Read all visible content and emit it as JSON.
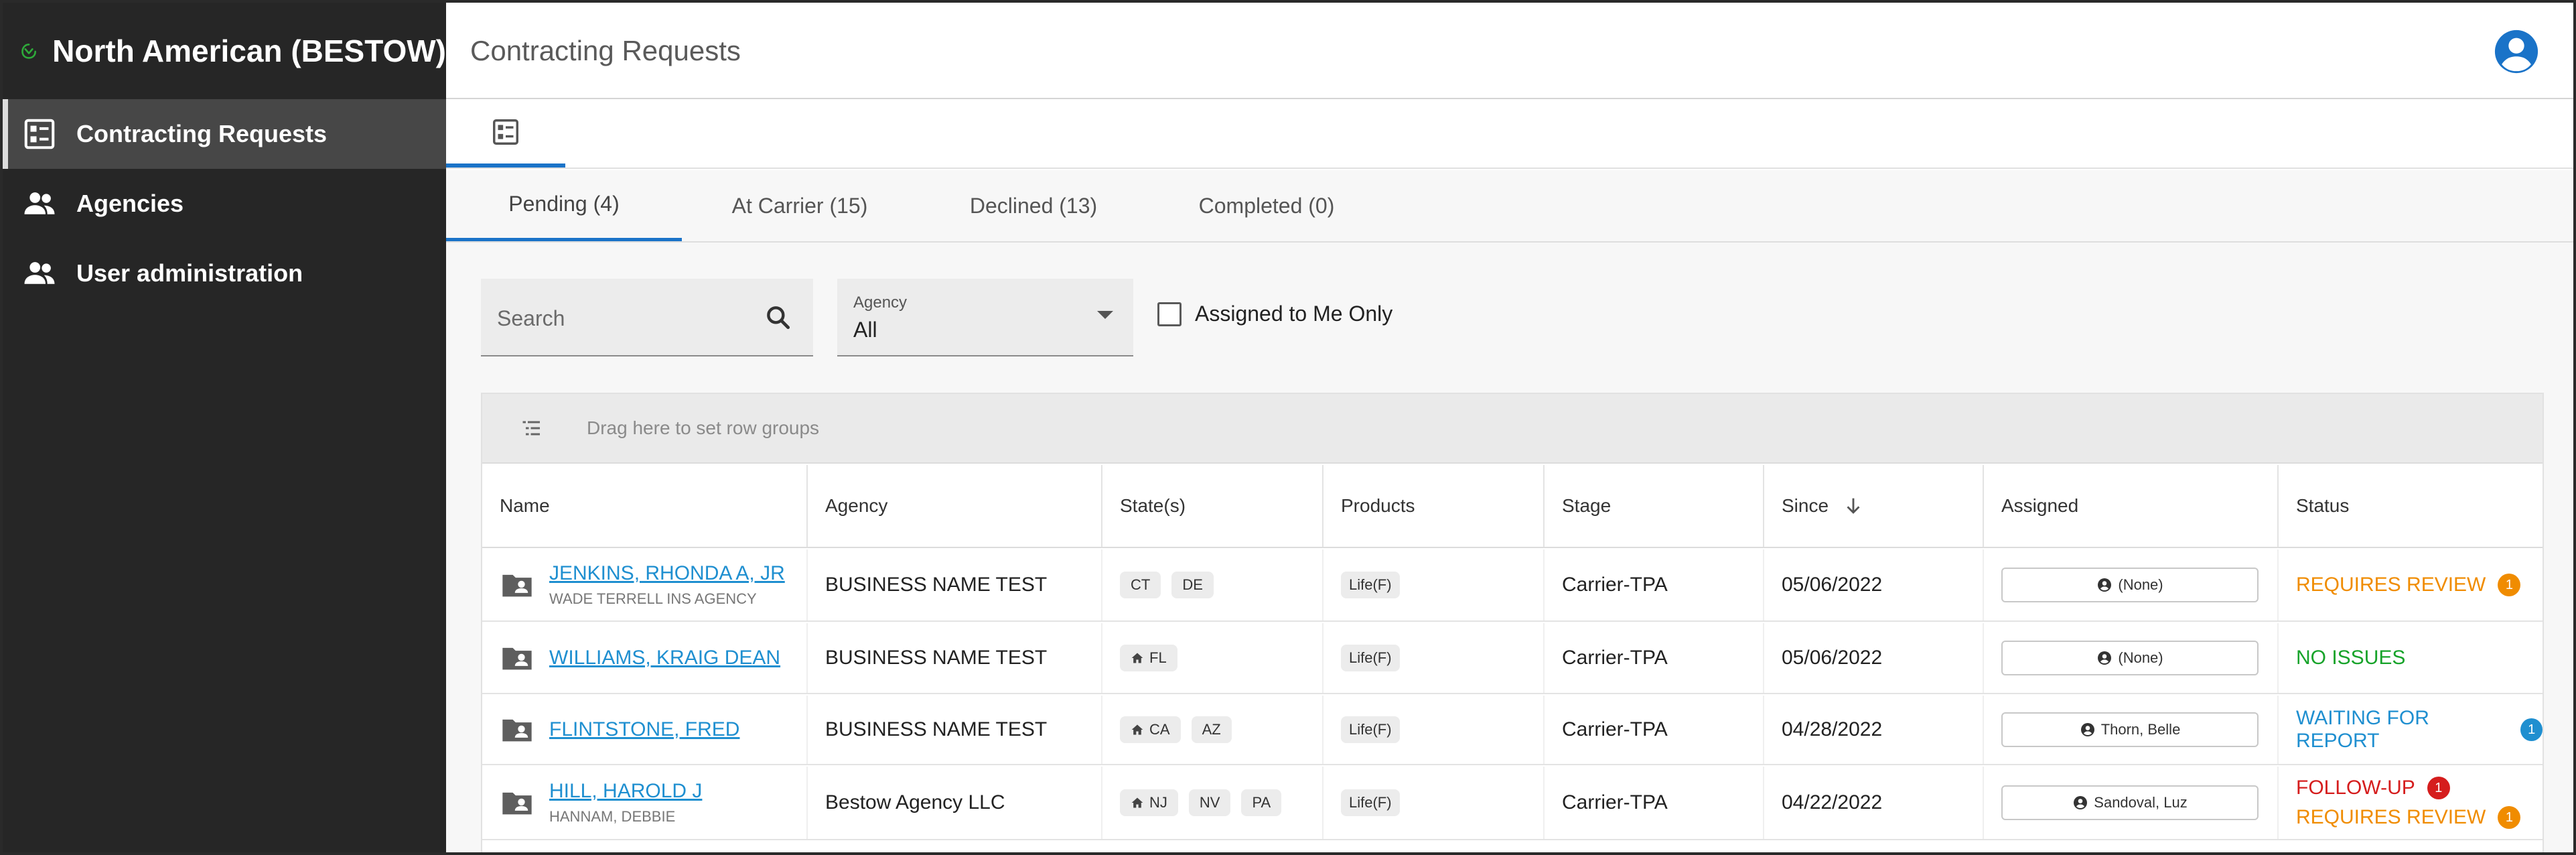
{
  "app": {
    "brand_name": "North American (BESTOW)",
    "page_title": "Contracting Requests"
  },
  "sidebar": {
    "items": [
      {
        "label": "Contracting Requests",
        "icon": "list-icon",
        "active": true
      },
      {
        "label": "Agencies",
        "icon": "people-icon",
        "active": false
      },
      {
        "label": "User administration",
        "icon": "people-icon",
        "active": false
      }
    ]
  },
  "tabs": [
    {
      "label": "Pending (4)",
      "active": true
    },
    {
      "label": "At Carrier (15)",
      "active": false
    },
    {
      "label": "Declined (13)",
      "active": false
    },
    {
      "label": "Completed (0)",
      "active": false
    }
  ],
  "filters": {
    "search_placeholder": "Search",
    "agency_label": "Agency",
    "agency_value": "All",
    "assigned_label": "Assigned to Me Only"
  },
  "grid": {
    "group_bar_text": "Drag here to set row groups",
    "columns": [
      "Name",
      "Agency",
      "State(s)",
      "Products",
      "Stage",
      "Since",
      "Assigned",
      "Status"
    ],
    "rows": [
      {
        "name": "JENKINS, RHONDA A, JR",
        "sub": "WADE TERRELL INS AGENCY",
        "agency": "BUSINESS NAME TEST",
        "states": [
          {
            "code": "CT",
            "home": false
          },
          {
            "code": "DE",
            "home": false
          }
        ],
        "product": "Life(F)",
        "stage": "Carrier-TPA",
        "since": "05/06/2022",
        "assigned": "(None)",
        "statuses": [
          {
            "text": "REQUIRES REVIEW",
            "color": "#f08c00",
            "count": "1"
          }
        ]
      },
      {
        "name": "WILLIAMS, KRAIG DEAN",
        "sub": "",
        "agency": "BUSINESS NAME TEST",
        "states": [
          {
            "code": "FL",
            "home": true
          }
        ],
        "product": "Life(F)",
        "stage": "Carrier-TPA",
        "since": "05/06/2022",
        "assigned": "(None)",
        "statuses": [
          {
            "text": "NO ISSUES",
            "color": "#17a32a",
            "count": ""
          }
        ]
      },
      {
        "name": "FLINTSTONE, FRED",
        "sub": "",
        "agency": "BUSINESS NAME TEST",
        "states": [
          {
            "code": "CA",
            "home": true
          },
          {
            "code": "AZ",
            "home": false
          }
        ],
        "product": "Life(F)",
        "stage": "Carrier-TPA",
        "since": "04/28/2022",
        "assigned": "Thorn, Belle",
        "statuses": [
          {
            "text": "WAITING FOR REPORT",
            "color": "#1f8fd0",
            "count": "1"
          }
        ]
      },
      {
        "name": "HILL, HAROLD J",
        "sub": "HANNAM, DEBBIE",
        "agency": "Bestow Agency LLC",
        "states": [
          {
            "code": "NJ",
            "home": true
          },
          {
            "code": "NV",
            "home": false
          },
          {
            "code": "PA",
            "home": false
          }
        ],
        "product": "Life(F)",
        "stage": "Carrier-TPA",
        "since": "04/22/2022",
        "assigned": "Sandoval, Luz",
        "statuses": [
          {
            "text": "FOLLOW-UP",
            "color": "#d51d1d",
            "count": "1"
          },
          {
            "text": "REQUIRES REVIEW",
            "color": "#f08c00",
            "count": "1"
          }
        ]
      }
    ]
  },
  "colors": {
    "sidebar_bg": "#262626",
    "accent_blue": "#1a73c8",
    "link_blue": "#1f8fd0",
    "brand_green": "#2eaa3a"
  }
}
